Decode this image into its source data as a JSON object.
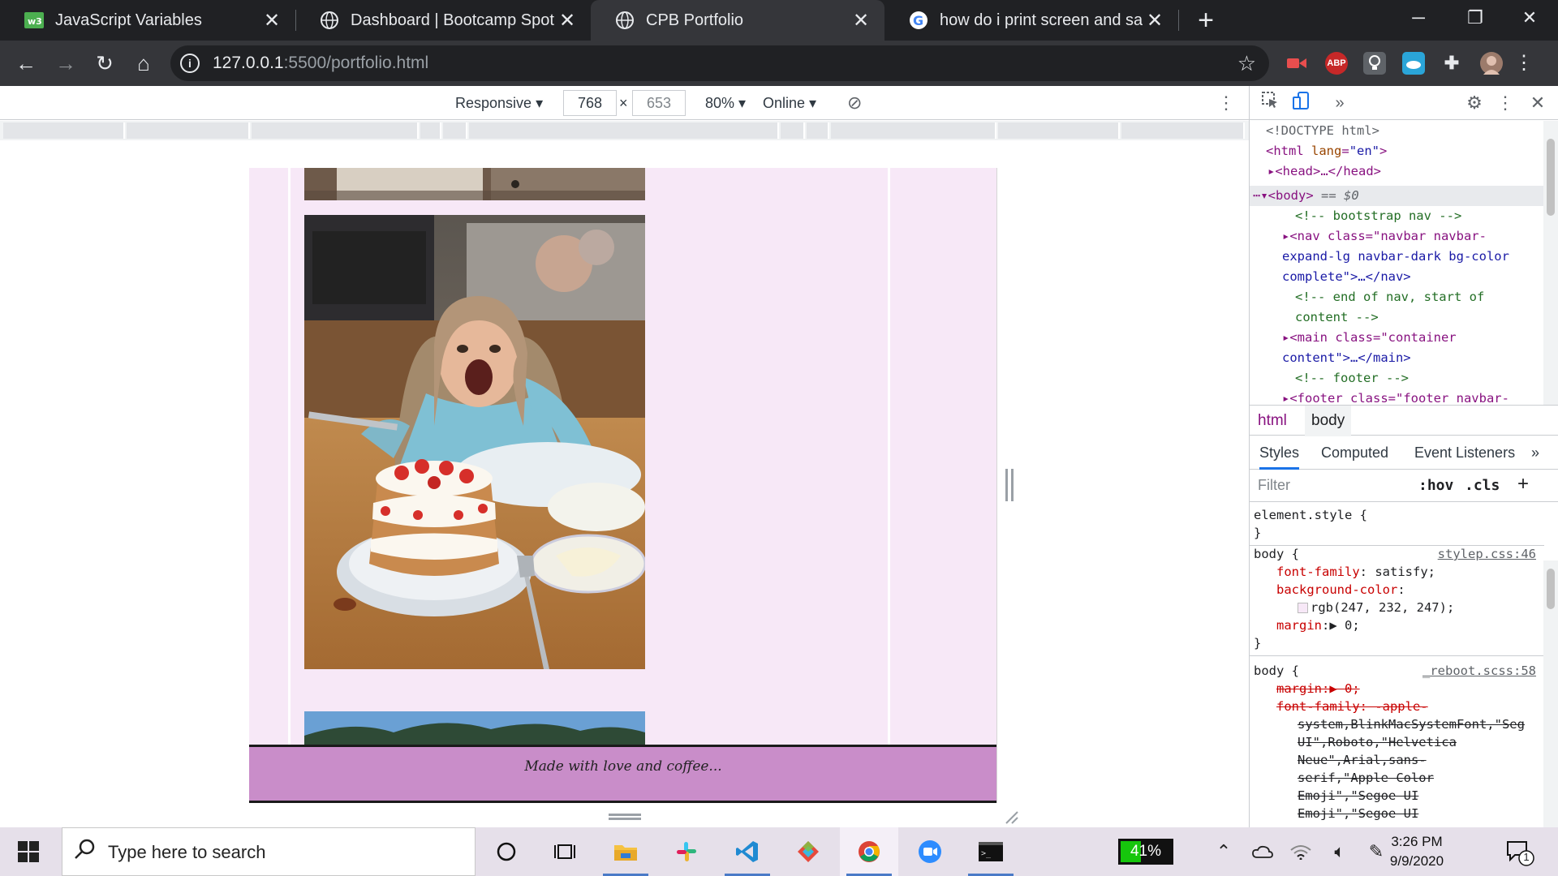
{
  "browser": {
    "tabs": [
      {
        "title": "JavaScript Variables",
        "favicon": "w3schools-icon",
        "fav_color": "#4caf50"
      },
      {
        "title": "Dashboard | Bootcamp Spot",
        "favicon": "globe-icon"
      },
      {
        "title": "CPB Portfolio",
        "favicon": "globe-icon",
        "active": true
      },
      {
        "title": "how do i print screen and save to",
        "favicon": "google-icon"
      }
    ],
    "new_tab": "+",
    "url_host": "127.0.0.1",
    "url_rest": ":5500/portfolio.html",
    "extensions": {
      "abp": "ABP"
    }
  },
  "device_toolbar": {
    "mode": "Responsive",
    "width": "768",
    "times": "×",
    "height": "653",
    "zoom": "80%",
    "throttle": "Online"
  },
  "page": {
    "footer_text": "Made with love and coffee..."
  },
  "devtools": {
    "elements": {
      "doctype": "<!DOCTYPE html>",
      "html_open": "html",
      "lang_attr": "lang",
      "lang_val": "\"en\"",
      "head": "<head>…</head>",
      "body": "<body>",
      "body_suffix": "== $0",
      "comment_nav": "<!-- bootstrap nav -->",
      "nav_line1": "<nav class=\"navbar navbar-",
      "nav_line2": "expand-lg navbar-dark bg-color",
      "nav_line3": "complete\">…</nav>",
      "comment_end_nav_1": "<!-- end of nav, start of",
      "comment_end_nav_2": "content -->",
      "main_line1": "<main class=\"container",
      "main_line2": "content\">…</main>",
      "comment_footer": "<!-- footer -->",
      "footer_line": "<footer class=\"footer navbar-"
    },
    "breadcrumbs": [
      "html",
      "body"
    ],
    "subtabs": [
      "Styles",
      "Computed",
      "Event Listeners"
    ],
    "filter_placeholder": "Filter",
    "hov": ":hov",
    "cls": ".cls",
    "styles": {
      "element_style": "element.style {",
      "close": "}",
      "rule1_selector": "body {",
      "rule1_source": "stylep.css:46",
      "rule1_props": [
        {
          "name": "font-family",
          "value": "satisfy;"
        },
        {
          "name": "background-color",
          "value": ""
        },
        {
          "name": "",
          "value": "rgb(247, 232, 247);"
        },
        {
          "name": "margin",
          "value": "▶ 0;"
        }
      ],
      "swatch_color": "#f7e8f7",
      "rule2_selector": "body {",
      "rule2_source": "_reboot.scss:58",
      "rule2_lines": [
        "margin:▶ 0;",
        "font-family: -apple-",
        "system,BlinkMacSystemFont,\"Seg",
        "UI\",Roboto,\"Helvetica",
        "Neue\",Arial,sans-",
        "serif,\"Apple Color",
        "Emoji\",\"Segoe UI",
        "Emoji\",\"Segoe UI"
      ]
    }
  },
  "taskbar": {
    "search_placeholder": "Type here to search",
    "battery": "41%",
    "battery_level": 0.41,
    "time": "3:26 PM",
    "date": "9/9/2020",
    "notifications": "1"
  }
}
